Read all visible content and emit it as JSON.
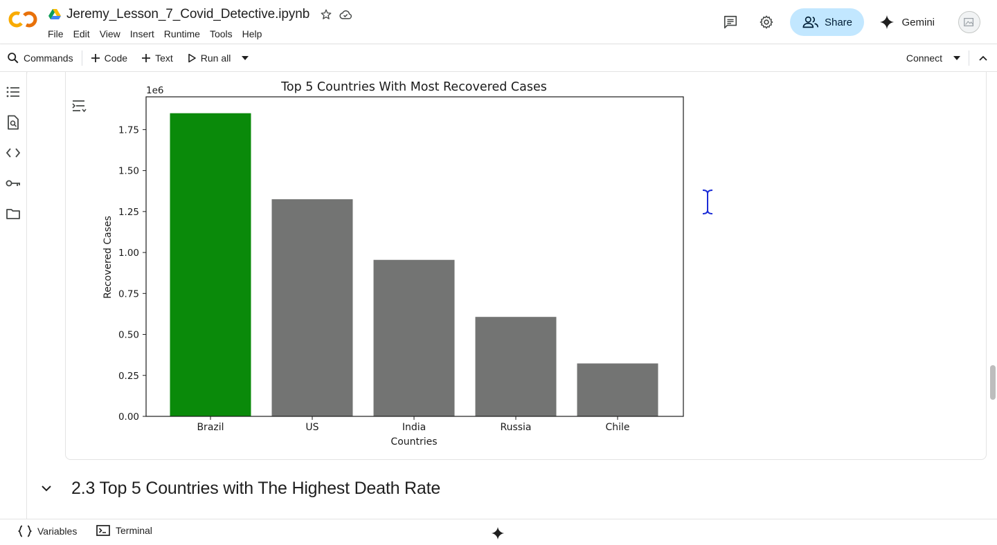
{
  "header": {
    "notebook_title": "Jeremy_Lesson_7_Covid_Detective.ipynb",
    "menu": [
      "File",
      "Edit",
      "View",
      "Insert",
      "Runtime",
      "Tools",
      "Help"
    ],
    "share_label": "Share",
    "gemini_label": "Gemini"
  },
  "toolbar": {
    "commands_label": "Commands",
    "code_label": "Code",
    "text_label": "Text",
    "run_all_label": "Run all",
    "connect_label": "Connect"
  },
  "notebook": {
    "section_title": "2.3 Top 5 Countries with The Highest Death Rate"
  },
  "statusbar": {
    "variables_label": "Variables",
    "terminal_label": "Terminal"
  },
  "colors": {
    "highlight_bar": "#0a8a0a",
    "other_bars": "#737473",
    "share_bg": "#c2e7ff"
  },
  "chart_data": {
    "type": "bar",
    "title": "Top 5 Countries With Most Recovered Cases",
    "xlabel": "Countries",
    "ylabel": "Recovered Cases",
    "scale_label": "1e6",
    "categories": [
      "Brazil",
      "US",
      "India",
      "Russia",
      "Chile"
    ],
    "values": [
      1.85,
      1.325,
      0.955,
      0.607,
      0.323
    ],
    "bar_colors": [
      "#0a8a0a",
      "#737473",
      "#737473",
      "#737473",
      "#737473"
    ],
    "ylim": [
      0,
      1.95
    ],
    "yticks": [
      "0.00",
      "0.25",
      "0.50",
      "0.75",
      "1.00",
      "1.25",
      "1.50",
      "1.75"
    ],
    "grid": false
  }
}
